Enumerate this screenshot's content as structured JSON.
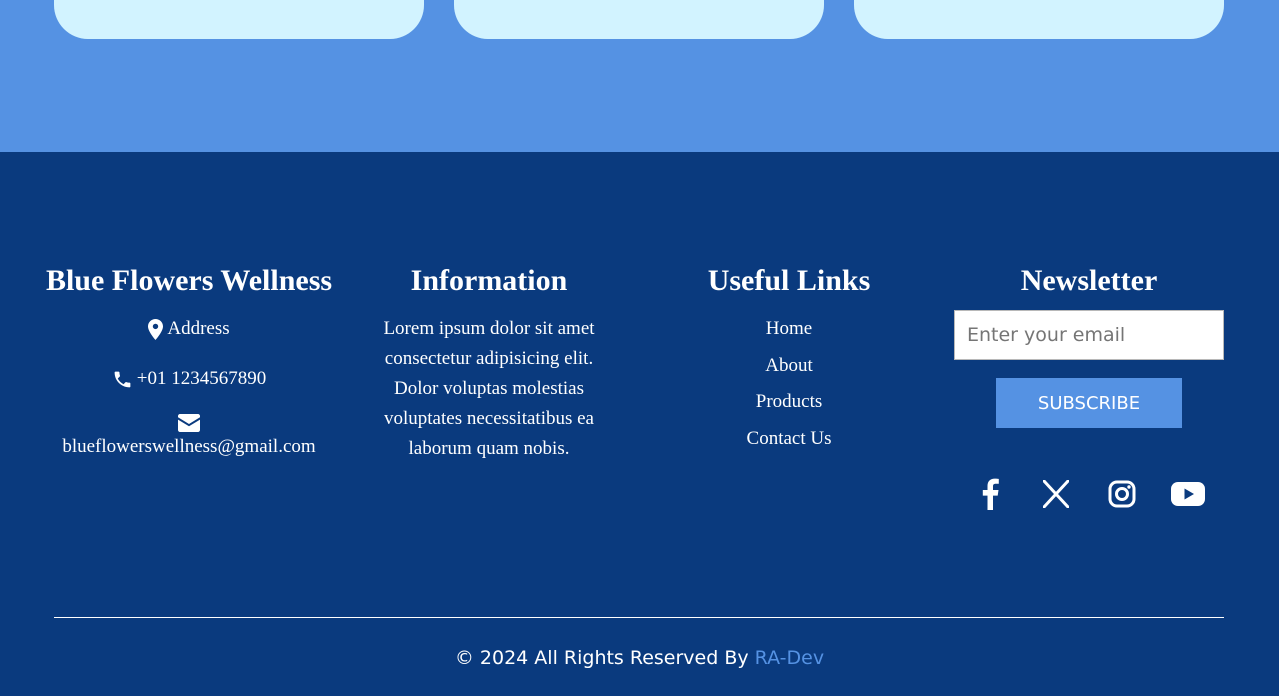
{
  "footer": {
    "brand": {
      "title": "Blue Flowers Wellness",
      "address": "Address",
      "phone": "+01 1234567890",
      "email": "blueflowerswellness@gmail.com"
    },
    "information": {
      "title": "Information",
      "text": "Lorem ipsum dolor sit amet consectetur adipisicing elit. Dolor voluptas molestias voluptates necessitatibus ea laborum quam nobis."
    },
    "useful_links": {
      "title": "Useful Links",
      "items": [
        "Home",
        "About",
        "Products",
        "Contact Us"
      ]
    },
    "newsletter": {
      "title": "Newsletter",
      "email_placeholder": "Enter your email",
      "subscribe_label": "SUBSCRIBE",
      "social_icons": [
        "facebook-icon",
        "x-icon",
        "instagram-icon",
        "youtube-icon"
      ]
    },
    "copyright": {
      "text": "© 2024 All Rights Reserved By",
      "link_text": "RA-Dev"
    }
  },
  "colors": {
    "top_band": "#5592e3",
    "card": "#d2f3ff",
    "footer_bg": "#0a3a7e",
    "accent": "#5592e3"
  }
}
